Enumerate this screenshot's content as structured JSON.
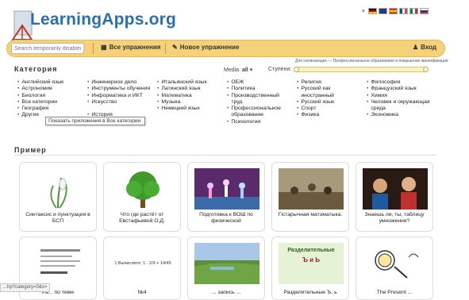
{
  "header": {
    "logo_text": "LearningApps.org",
    "languages": [
      "de-flag-icon",
      "en-flag-icon",
      "es-flag-icon",
      "fr-flag-icon",
      "it-flag-icon",
      "ru-flag-icon"
    ]
  },
  "toolbar": {
    "search_placeholder": "Search temporarily disabled",
    "all_exercises": "Все упражнения",
    "new_exercise": "Новое упражнение",
    "login": "Вход"
  },
  "category": {
    "title": "Категория",
    "media_label": "Media:",
    "media_value": "all",
    "levels_label": "Ступени:",
    "slider_caption": "Для начинающих — Профессиональное образование и повышение квалификации",
    "columns": [
      [
        "Английский язык",
        "Астрономия",
        "Биология",
        "Все категории",
        "География",
        "Другие"
      ],
      [
        "Инженерное дело",
        "Инструменты обучения",
        "Информатика и ИКТ",
        "Искусство",
        "",
        "История"
      ],
      [
        "Итальянский язык",
        "Латинский язык",
        "Математика",
        "Музыка",
        "Немецкий язык"
      ],
      [
        "ОБЖ",
        "Политика",
        "Производственный труд",
        "Профессиональное образование",
        "Психология"
      ],
      [
        "Религия",
        "Русский как иностранный",
        "Русский язык",
        "Спорт",
        "Физика"
      ],
      [
        "Философия",
        "Французский язык",
        "Химия",
        "Человек и окружающая среда",
        "Экономика"
      ]
    ],
    "tooltip": "Показать приложения в Все категории."
  },
  "examples": {
    "title": "Пример",
    "row1": [
      {
        "title": "Синтаксис и пунктуация в БСП",
        "icon": "snowdrop-flower-icon"
      },
      {
        "title": "Что где растёт от Евстафьевой О.Д.",
        "icon": "tree-icon"
      },
      {
        "title": "Подготовка к ВОШ по физической",
        "icon": "gymnastics-photo-icon"
      },
      {
        "title": "Гістарычная матэматыка.",
        "icon": "history-painting-icon"
      },
      {
        "title": "Знаешь ли, ты, таблицу умножения?",
        "icon": "kids-photo-icon"
      }
    ],
    "row2": [
      {
        "title": "Ра... по теме",
        "icon": "document-lines-icon"
      },
      {
        "title": "№4",
        "icon": "fraction-formula-icon",
        "formula": "1 Вычислите: 1 · 2/9 + 14/45"
      },
      {
        "title": "... запись ...",
        "icon": "landscape-photo-icon"
      },
      {
        "title": "Разделительные Ъ, ь",
        "icon": "letters-icon",
        "card_text": "Разделительные",
        "letters": "Ъ и Ь"
      },
      {
        "title": "The Present ...",
        "icon": "cartoon-icon"
      }
    ]
  },
  "statusbar": {
    "url": "...hp?category=0&s="
  }
}
